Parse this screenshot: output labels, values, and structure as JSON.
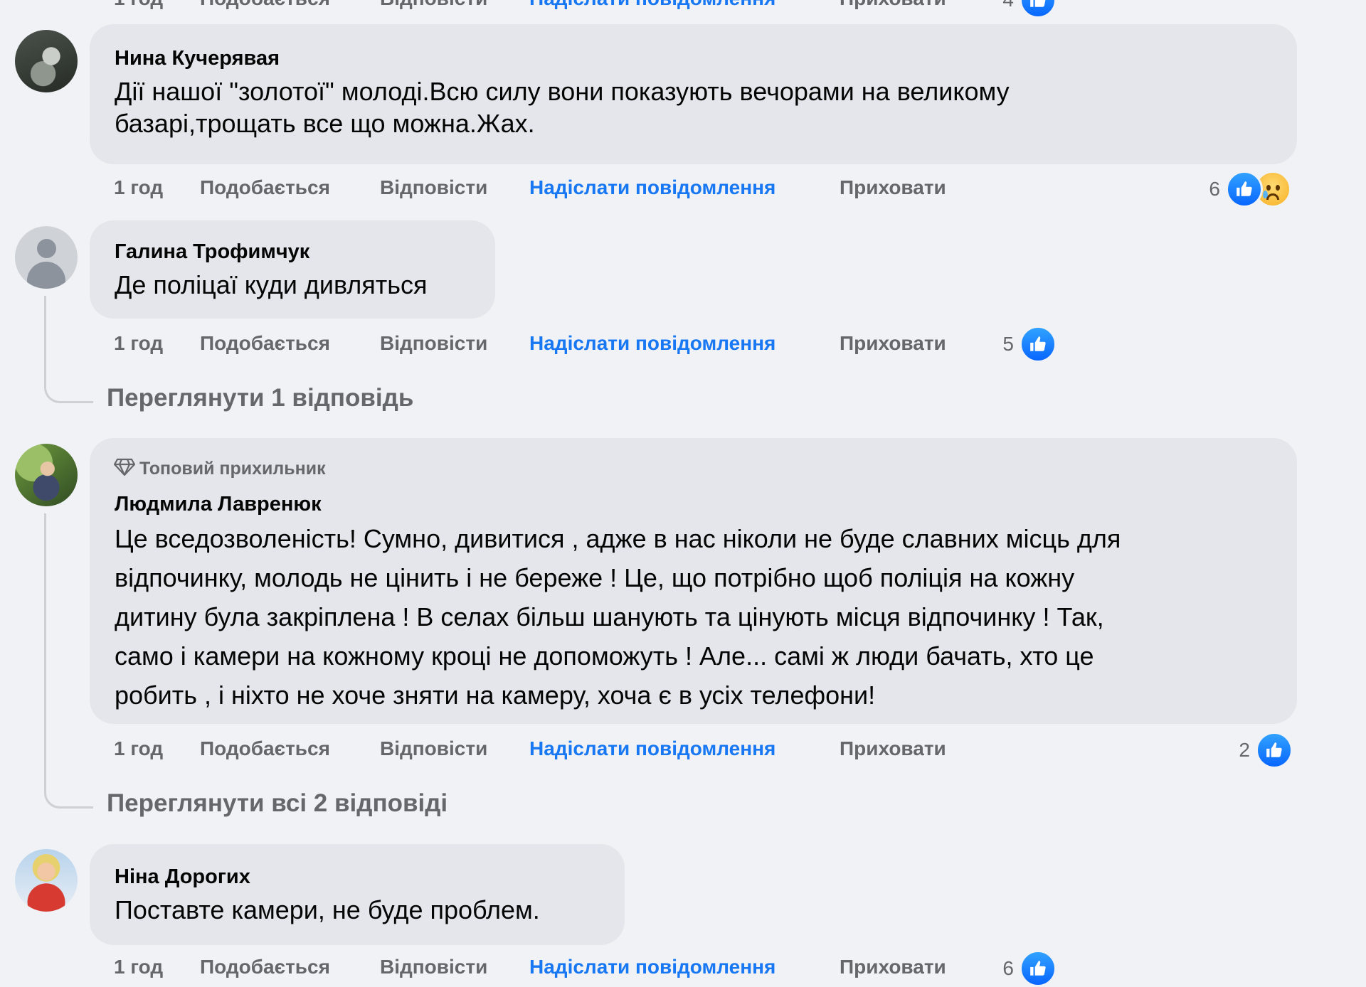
{
  "colors": {
    "page_bg": "#f0f2f5",
    "bubble_bg": "#e4e6eb",
    "link_blue": "#1877f2",
    "secondary_text": "#65676b"
  },
  "actions": {
    "time": "1 год",
    "like": "Подобається",
    "reply": "Відповісти",
    "send_message": "Надіслати повідомлення",
    "hide": "Приховати"
  },
  "top_partial": {
    "reaction_count": "4"
  },
  "comments": [
    {
      "author": "Нина Кучерявая",
      "text": "Дії нашої \"золотої\" молоді.Всю силу вони показують вечорами на великому базарі,трощать все що можна.Жах.",
      "reaction_count": "6",
      "reactions": [
        "like-icon",
        "sad-icon"
      ]
    },
    {
      "author": "Галина Трофимчук",
      "text": "Де поліцаї куди дивляться",
      "reaction_count": "5",
      "reactions": [
        "like-icon"
      ],
      "view_replies": "Переглянути 1 відповідь"
    },
    {
      "badge": "Топовий прихильник",
      "author": "Людмила Лавренюк",
      "text_lines": [
        "Це вседозволеність! Сумно, дивитися , адже в нас ніколи не буде славних місць для",
        "відпочинку, молодь не цінить і не береже ! Це, що потрібно щоб поліція на кожну",
        "дитину була закріплена ! В селах більш шанують та цінують місця відпочинку ! Так,",
        "само і камери на кожному кроці не допоможуть ! Але... самі ж люди бачать, хто це",
        "робить , і ніхто не хоче зняти на камеру, хоча є в усіх телефони!"
      ],
      "reaction_count": "2",
      "reactions": [
        "like-icon"
      ],
      "view_replies": "Переглянути всі 2 відповіді"
    },
    {
      "author": "Ніна Дорогих",
      "text": "Поставте камери, не буде проблем.",
      "reaction_count": "6",
      "reactions": [
        "like-icon"
      ]
    }
  ]
}
